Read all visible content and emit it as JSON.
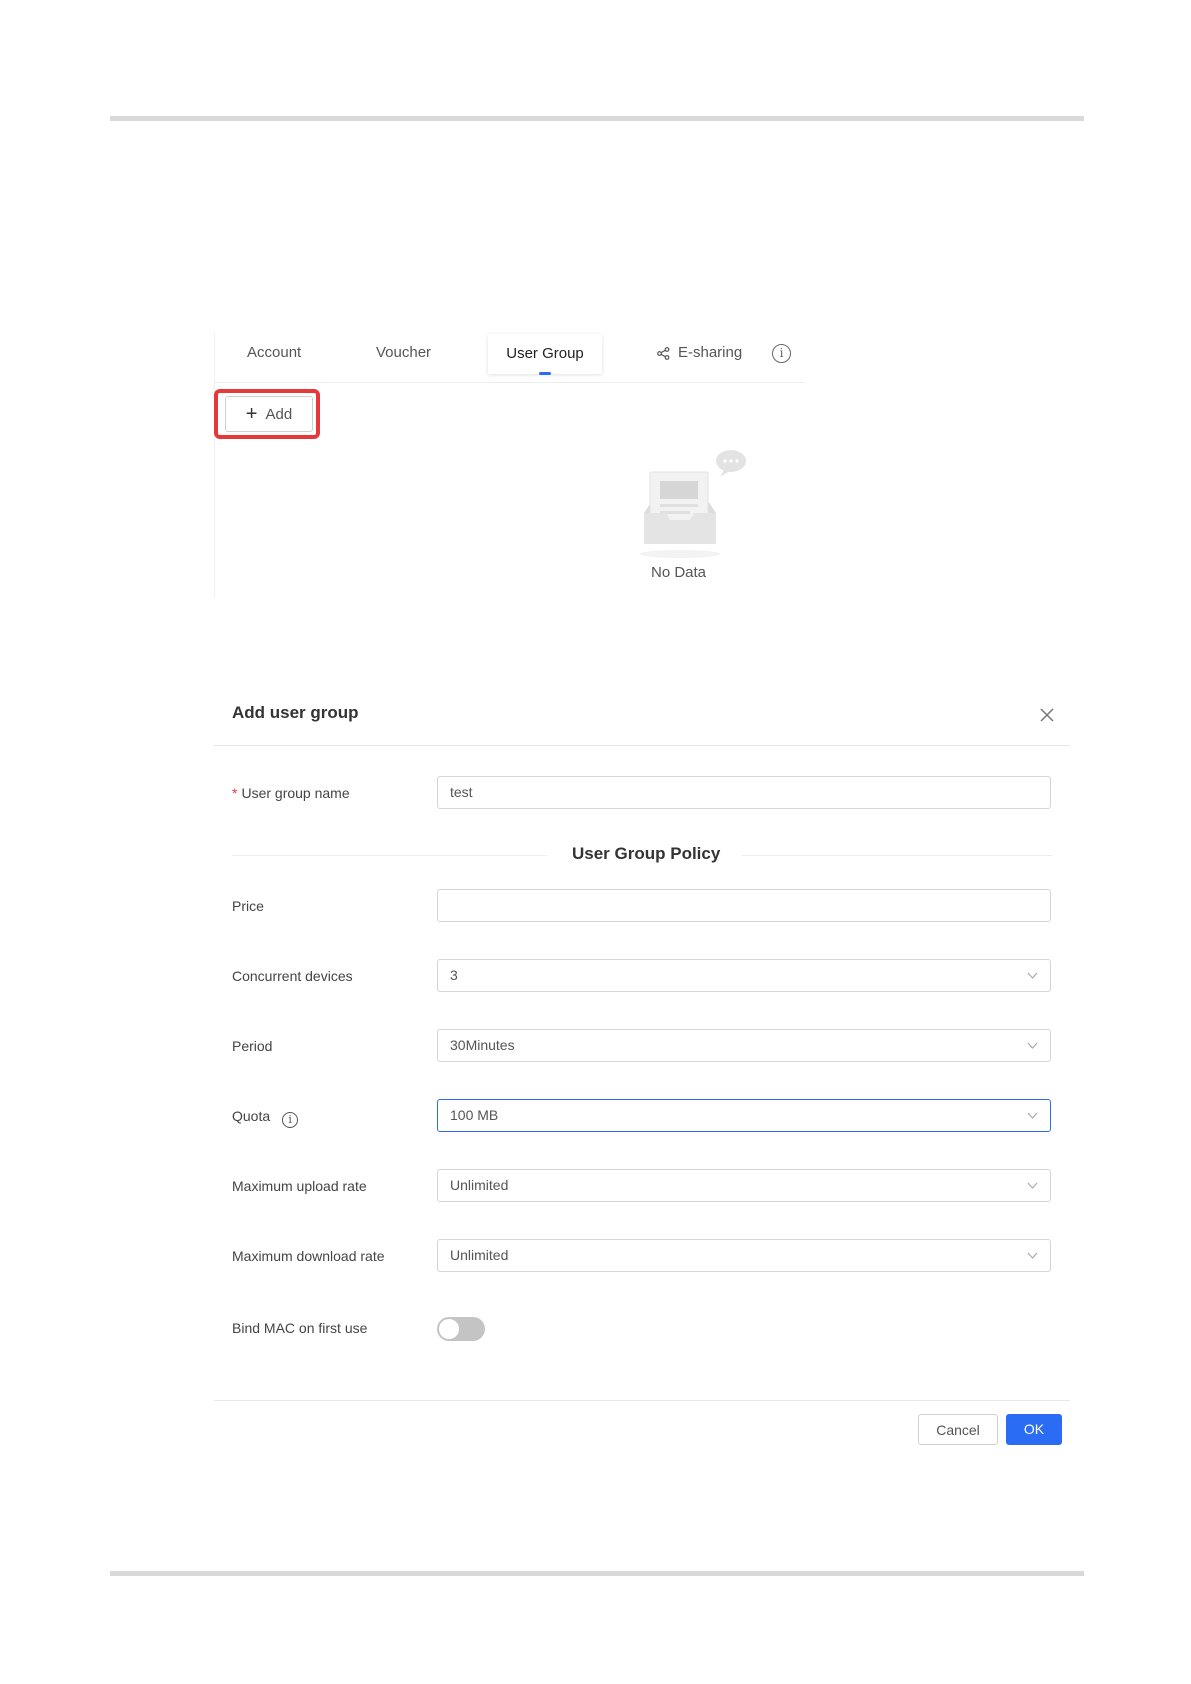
{
  "tabs": {
    "account": "Account",
    "voucher": "Voucher",
    "user_group": "User Group",
    "esharing": "E-sharing",
    "info_glyph": "i"
  },
  "toolbar": {
    "add_label": "Add"
  },
  "empty_state": {
    "text": "No Data"
  },
  "dialog": {
    "title": "Add user group",
    "fields": {
      "user_group_name": {
        "label": "User group name",
        "value": "test"
      },
      "section_title": "User Group Policy",
      "price": {
        "label": "Price",
        "value": ""
      },
      "concurrent_devices": {
        "label": "Concurrent devices",
        "value": "3"
      },
      "period": {
        "label": "Period",
        "value": "30Minutes"
      },
      "quota": {
        "label": "Quota",
        "value": "100 MB"
      },
      "max_upload": {
        "label": "Maximum upload rate",
        "value": "Unlimited"
      },
      "max_download": {
        "label": "Maximum download rate",
        "value": "Unlimited"
      },
      "bind_mac": {
        "label": "Bind MAC on first use",
        "enabled": false
      }
    },
    "cancel_label": "Cancel",
    "ok_label": "OK"
  },
  "colors": {
    "accent": "#2a6df4",
    "highlight": "#e5393a",
    "toggle_off": "#c4c4c4"
  }
}
